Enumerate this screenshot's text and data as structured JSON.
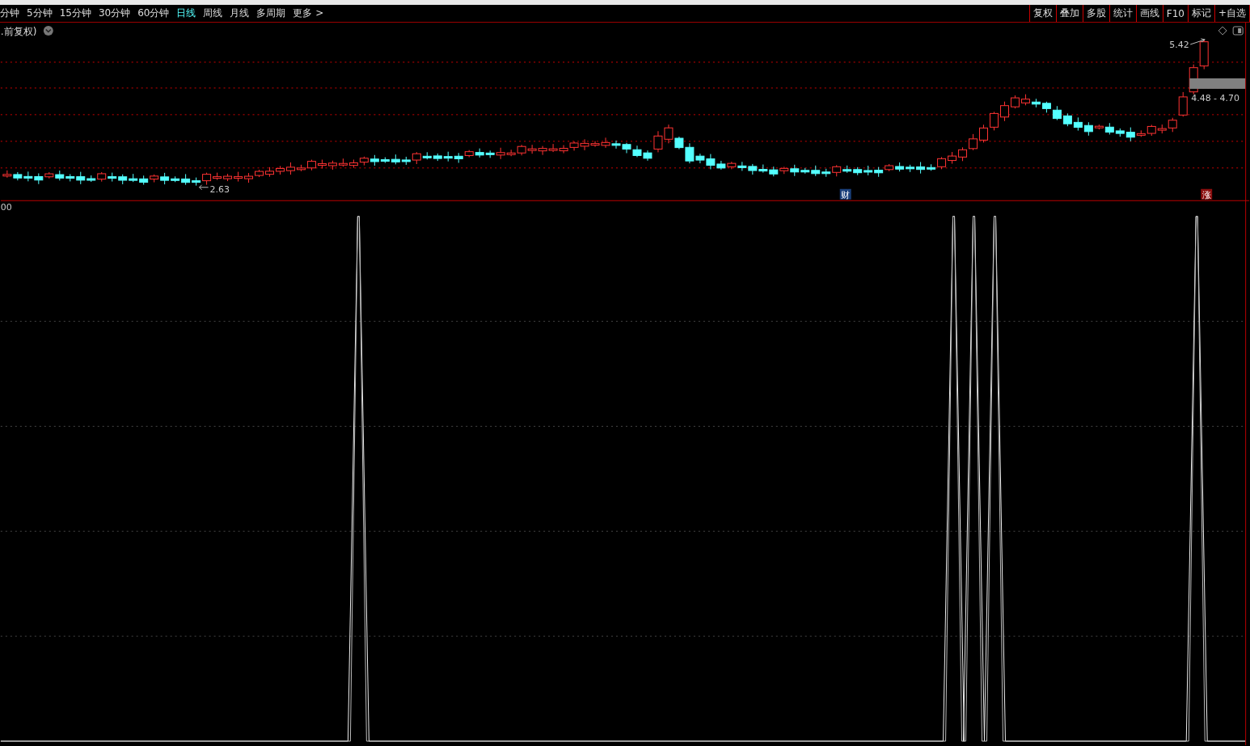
{
  "toolbar": {
    "periods": [
      {
        "label": "分钟",
        "selected": false
      },
      {
        "label": "5分钟",
        "selected": false
      },
      {
        "label": "15分钟",
        "selected": false
      },
      {
        "label": "30分钟",
        "selected": false
      },
      {
        "label": "60分钟",
        "selected": false
      },
      {
        "label": "日线",
        "selected": true
      },
      {
        "label": "周线",
        "selected": false
      },
      {
        "label": "月线",
        "selected": false
      },
      {
        "label": "多周期",
        "selected": false
      },
      {
        "label": "更多 >",
        "selected": false
      }
    ],
    "tools": [
      "复权",
      "叠加",
      "多股",
      "统计",
      "画线",
      "F10",
      "标记",
      "+自选"
    ]
  },
  "price_chart": {
    "adjust_label": ".前复权)",
    "high_label": "5.42",
    "low_label": "2.63",
    "range_label": "4.48 - 4.70",
    "event_markers": [
      {
        "label": "财",
        "kind": "finance"
      },
      {
        "label": "涨",
        "kind": "rise"
      }
    ]
  },
  "indicator": {
    "axis_label": "00"
  }
}
